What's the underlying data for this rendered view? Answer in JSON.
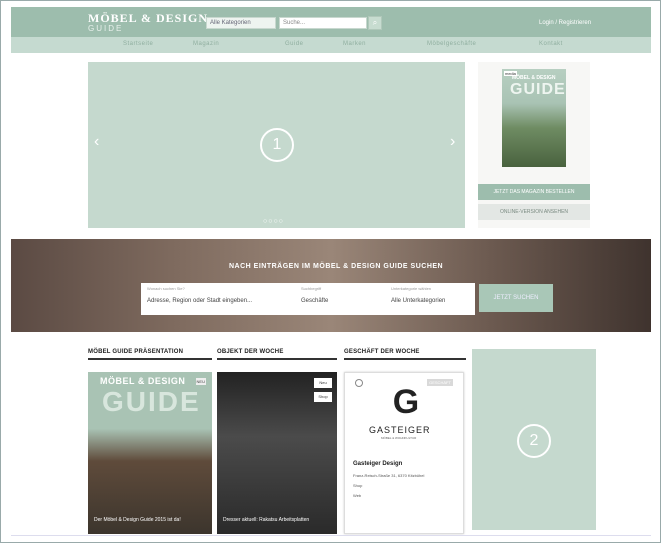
{
  "header": {
    "logo_line1": "MÖBEL & DESIGN",
    "logo_line2": "GUIDE",
    "category_select": "Alle Kategorien",
    "search_placeholder": "Suche...",
    "search_button_icon": "search-icon",
    "login_text": "Login / Registrieren"
  },
  "nav": {
    "items": [
      "Startseite",
      "Magazin",
      "Guide",
      "Marken",
      "Möbelgeschäfte",
      "Kontakt"
    ]
  },
  "hero": {
    "marker": "1",
    "prev_icon": "chevron-left-icon",
    "next_icon": "chevron-right-icon",
    "dots": "○○○○"
  },
  "magazine": {
    "badge": "media",
    "title": "MÖBEL & DESIGN",
    "guide": "GUIDE",
    "button_primary": "JETZT DAS MAGAZIN BESTELLEN",
    "button_secondary": "ONLINE-VERSION ANSEHEN"
  },
  "search_band": {
    "title": "NACH EINTRÄGEN IM MÖBEL & DESIGN GUIDE SUCHEN",
    "where_label": "Wonach suchen Sie?",
    "where_value": "Adresse, Region oder Stadt eingeben...",
    "type_label": "Suchbegriff",
    "type_value": "Geschäfte",
    "sub_label": "Unterkategorie wählen",
    "sub_value": "Alle Unterkategorien",
    "button": "JETZT SUCHEN"
  },
  "sections": {
    "s1": "MÖBEL GUIDE PRÄSENTATION",
    "s2": "OBJEKT DER WOCHE",
    "s3": "GESCHÄFT DER WOCHE"
  },
  "card1": {
    "title": "MÖBEL & DESIGN",
    "guide": "GUIDE",
    "badge": "NEU",
    "caption": "Der Möbel & Design Guide 2015 ist da!"
  },
  "card2": {
    "badge1": "Neu",
    "badge2": "Shop",
    "caption": "Dresser aktuell: Rakatsu Arbeitsplatten"
  },
  "card3": {
    "logo": "G",
    "name": "GASTEIGER",
    "sub": "MÖBEL & WOHNKULTUR",
    "tag": "GESCHÄFT",
    "title": "Gasteiger Design",
    "lines": [
      "Franz-Reisch-Straße 31, 6370 Kitzbühel",
      "Shop",
      "Web"
    ]
  },
  "ad2": {
    "marker": "2"
  },
  "colors": {
    "accent": "#9dbdad",
    "placeholder_green": "#c5d9ce"
  }
}
